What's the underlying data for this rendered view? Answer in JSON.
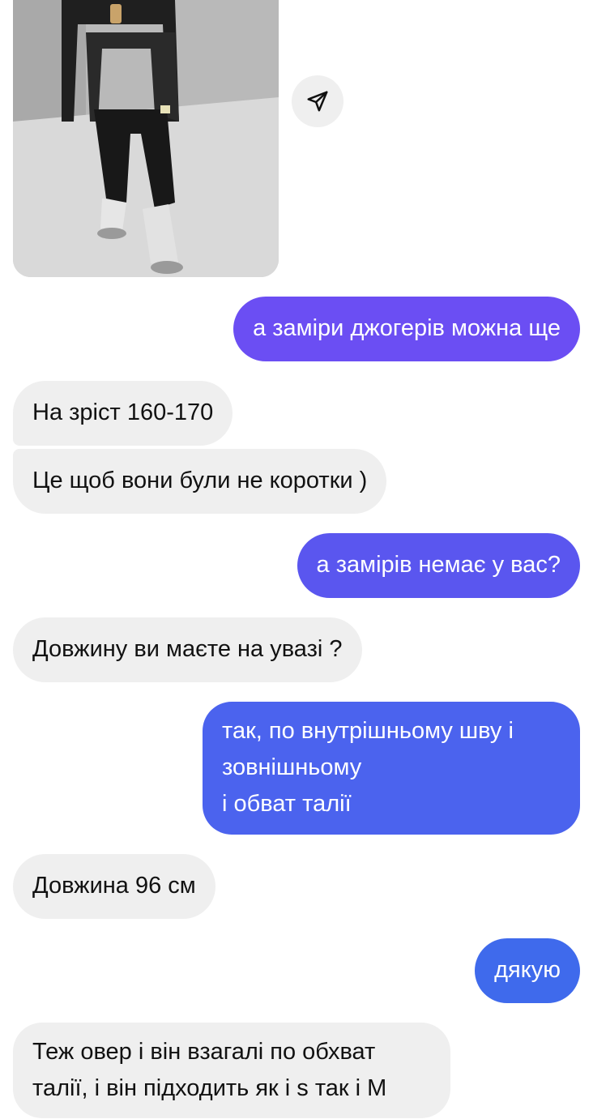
{
  "thread": {
    "photo_alt": "Фото: чорний спортивний костюм",
    "share_icon": "paper-plane-icon",
    "messages": [
      {
        "from": "me",
        "text": "а заміри джогерів можна ще"
      },
      {
        "from": "them",
        "text": "На зріст 160-170"
      },
      {
        "from": "them",
        "text": "Це щоб вони були не коротки )"
      },
      {
        "from": "me",
        "text": "а замірів немає у вас?"
      },
      {
        "from": "them",
        "text": "Довжину ви маєте на увазі ?"
      },
      {
        "from": "me",
        "lines": [
          "так, по внутрішньому шву і",
          "зовнішньому",
          "і обват талії"
        ]
      },
      {
        "from": "them",
        "text": "Довжина 96 см"
      },
      {
        "from": "me",
        "text": "дякую"
      },
      {
        "from": "them",
        "lines": [
          "Теж овер і він взагалі по обхват",
          "талії, і він підходить як і s так і M"
        ]
      }
    ]
  },
  "colors": {
    "outgoing_top": "#6b4ef3",
    "outgoing_bottom": "#3f6aec",
    "incoming": "#efefef"
  }
}
